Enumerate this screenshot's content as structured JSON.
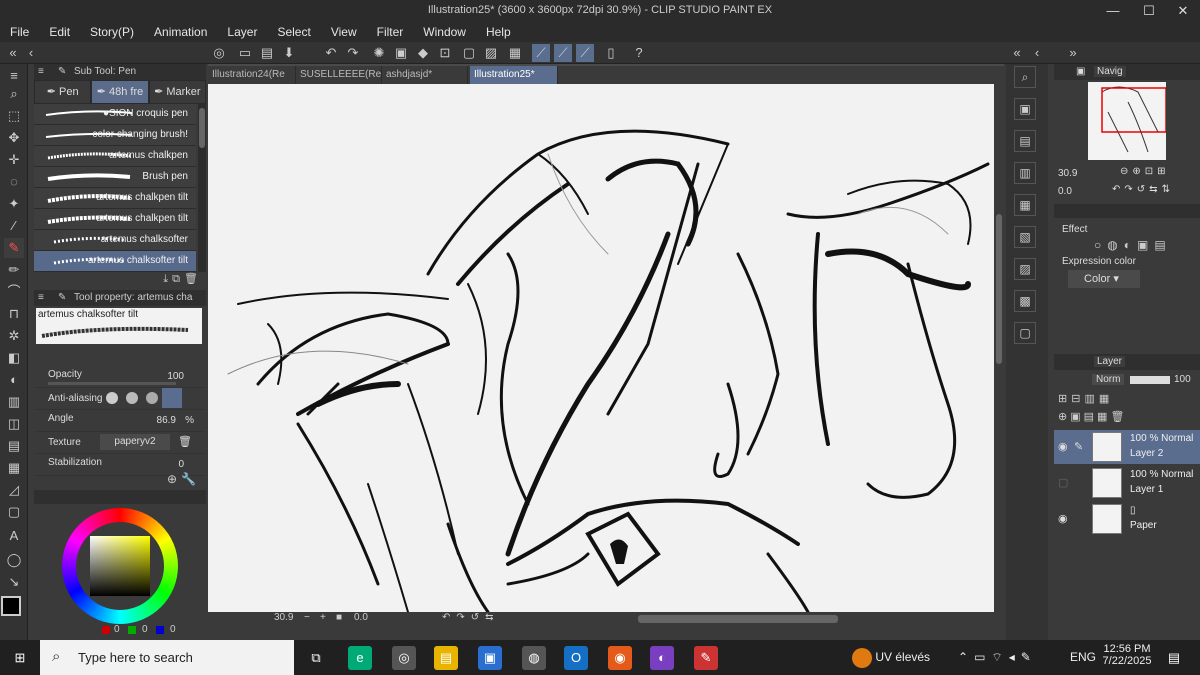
{
  "window": {
    "title": "Illustration25* (3600 x 3600px 72dpi 30.9%) - CLIP STUDIO PAINT EX",
    "minimize": "—",
    "restore": "☐",
    "close": "✕"
  },
  "menu": [
    "File",
    "Edit",
    "Story(P)",
    "Animation",
    "Layer",
    "Select",
    "View",
    "Filter",
    "Window",
    "Help"
  ],
  "subtool": {
    "header": "Sub Tool: Pen",
    "tabs": [
      "Pen",
      "48h fre",
      "Marker"
    ],
    "brushes": [
      "●SION croquis pen",
      "color changing brush!",
      "artemus chalkpen",
      "Brush pen",
      "artemus chalkpen tilt",
      "artemus chalkpen tilt",
      "artemus chalksofter",
      "artemus chalksofter tilt"
    ]
  },
  "toolprop": {
    "header": "Tool property: artemus cha",
    "preview_name": "artemus chalksofter tilt",
    "opacity_label": "Opacity",
    "opacity_value": "100",
    "antialias_label": "Anti-aliasing",
    "angle_label": "Angle",
    "angle_value": "86.9",
    "angle_unit": "%",
    "texture_label": "Texture",
    "texture_value": "paperyv2",
    "stabilization_label": "Stabilization",
    "stabilization_value": "0"
  },
  "color": {
    "main": "#000000",
    "sub": "#1a1a1a",
    "r": "0",
    "g": "0",
    "b": "0"
  },
  "doc_tabs": [
    "Illustration24(Re",
    "SUSELLEEEE(Re",
    "ashdjasjd*",
    "Illustration25*"
  ],
  "canvas_footer": {
    "zoom": "30.9",
    "angle": "0.0"
  },
  "navigator": {
    "tab": "Navig",
    "zoom": "30.9",
    "angle": "0.0"
  },
  "effect": {
    "header": "Effect",
    "expression_label": "Expression color",
    "expression_value": "Color"
  },
  "layers": {
    "tab": "Layer",
    "blend": "Norm",
    "opacity": "100",
    "rows": [
      {
        "mode": "100 % Normal",
        "name": "Layer 2"
      },
      {
        "mode": "100 % Normal",
        "name": "Layer 1"
      },
      {
        "mode": "",
        "name": "Paper"
      }
    ]
  },
  "taskbar": {
    "search_placeholder": "Type here to search",
    "weather": "UV élevés",
    "lang": "ENG",
    "time": "12:56 PM",
    "date": "7/22/2025"
  }
}
